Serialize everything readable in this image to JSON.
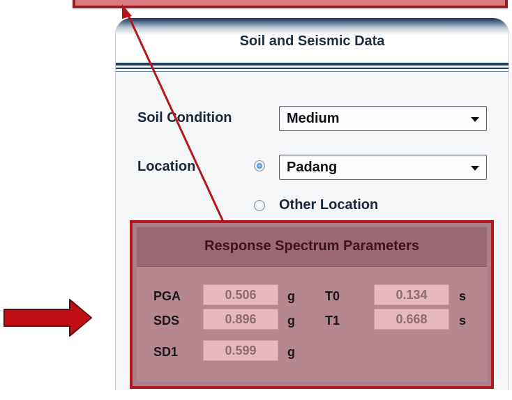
{
  "panel": {
    "title": "Soil and Seismic Data"
  },
  "soil": {
    "label": "Soil Condition",
    "selected": "Medium"
  },
  "location": {
    "label": "Location",
    "selected": "Padang",
    "other_label": "Other Location",
    "radio_selected": "Padang"
  },
  "response_spectrum": {
    "title": "Response Spectrum Parameters",
    "params": {
      "pga": {
        "label": "PGA",
        "value": "0.506",
        "unit": "g"
      },
      "sds": {
        "label": "SDS",
        "value": "0.896",
        "unit": "g"
      },
      "sd1": {
        "label": "SD1",
        "value": "0.599",
        "unit": "g"
      },
      "t0": {
        "label": "T0",
        "value": "0.134",
        "unit": "s"
      },
      "t1": {
        "label": "T1",
        "value": "0.668",
        "unit": "s"
      }
    }
  },
  "colors": {
    "highlight_red": "#b3171c",
    "header_navy": "#1f3c63",
    "rs_background": "#a98088"
  }
}
